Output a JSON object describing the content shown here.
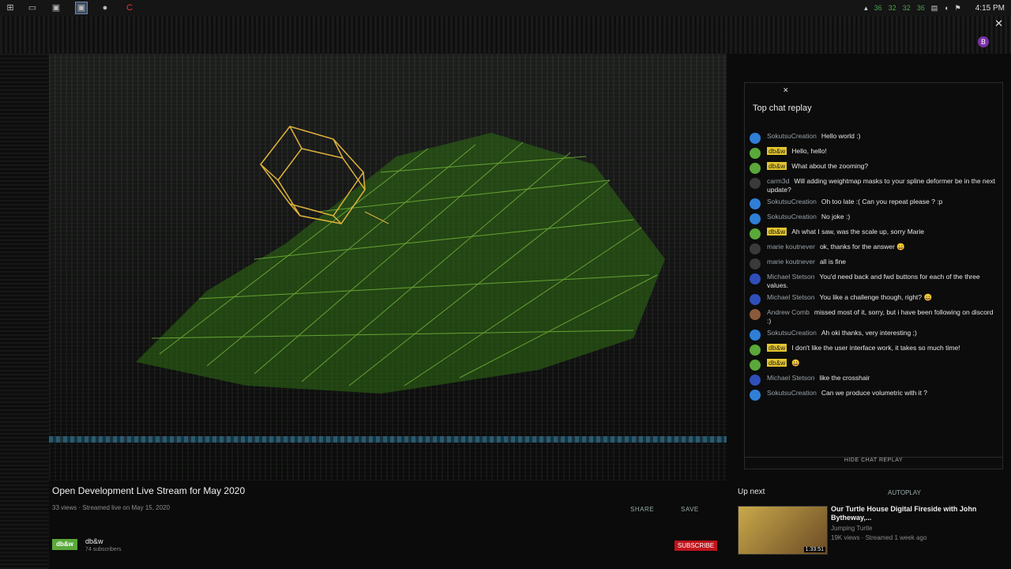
{
  "taskbar": {
    "icons": [
      "windows-start",
      "file-explorer",
      "window",
      "window-active",
      "chrome",
      "app-c"
    ],
    "tray_numbers": [
      "36",
      "32",
      "32",
      "36"
    ],
    "clock": "4:15 PM"
  },
  "browser": {
    "avatar_letter": "B"
  },
  "chat": {
    "title": "Top chat replay",
    "hide_label": "HIDE CHAT REPLAY",
    "messages": [
      {
        "author": "SokutsuCreation",
        "text": "Hello world :)",
        "avatar_color": "#2f7fd6",
        "badge": false
      },
      {
        "author": "db&w",
        "text": "Hello, hello!",
        "avatar_color": "#5aa83a",
        "badge": true
      },
      {
        "author": "db&w",
        "text": "What about the zooming?",
        "avatar_color": "#5aa83a",
        "badge": true
      },
      {
        "author": "carm3d",
        "text": "Will adding weightmap masks to your spline deformer be in the next update?",
        "avatar_color": "#3a3a3a",
        "badge": false
      },
      {
        "author": "SokutsuCreation",
        "text": "Oh too late :( Can you repeat please ? :p",
        "avatar_color": "#2f7fd6",
        "badge": false
      },
      {
        "author": "SokutsuCreation",
        "text": "No joke :)",
        "avatar_color": "#2f7fd6",
        "badge": false
      },
      {
        "author": "db&w",
        "text": "Ah what I saw, was the scale up, sorry Marie",
        "avatar_color": "#5aa83a",
        "badge": true
      },
      {
        "author": "marie koutnever",
        "text": "ok, thanks for the answer 😀",
        "avatar_color": "#3a3a3a",
        "badge": false
      },
      {
        "author": "marie koutnever",
        "text": "all is fine",
        "avatar_color": "#3a3a3a",
        "badge": false
      },
      {
        "author": "Michael Stetson",
        "text": "You'd need back and fwd buttons for each of the three values.",
        "avatar_color": "#2f4fb8",
        "badge": false
      },
      {
        "author": "Michael Stetson",
        "text": "You like a challenge though, right? 😀",
        "avatar_color": "#2f4fb8",
        "badge": false
      },
      {
        "author": "Andrew Comb",
        "text": "missed most of it, sorry, but i have been following on discord :)",
        "avatar_color": "#8a5a3a",
        "badge": false
      },
      {
        "author": "SokutsuCreation",
        "text": "Ah oki thanks, very interesting ;)",
        "avatar_color": "#2f7fd6",
        "badge": false
      },
      {
        "author": "db&w",
        "text": "I don't like the user interface work, it takes so much time!",
        "avatar_color": "#5aa83a",
        "badge": true
      },
      {
        "author": "db&w",
        "text": "😀",
        "avatar_color": "#5aa83a",
        "badge": true
      },
      {
        "author": "Michael Stetson",
        "text": "like the crosshair",
        "avatar_color": "#2f4fb8",
        "badge": false
      },
      {
        "author": "SokutsuCreation",
        "text": "Can we produce volumetric with it ?",
        "avatar_color": "#2f7fd6",
        "badge": false
      }
    ]
  },
  "video": {
    "title": "Open Development Live Stream for May 2020",
    "meta": "33 views · Streamed live on May 15, 2020",
    "share_label": "SHARE",
    "save_label": "SAVE",
    "channel_logo": "db&w",
    "channel_name": "db&w",
    "subscribers": "74 subscribers",
    "subscribe_label": "SUBSCRIBE"
  },
  "upnext": {
    "label": "Up next",
    "autoplay_label": "AUTOPLAY",
    "title": "Our Turtle House Digital Fireside with John Bytheway,...",
    "channel": "Jumping Turtle",
    "views": "19K views · Streamed 1 week ago",
    "duration": "1:33:51"
  }
}
